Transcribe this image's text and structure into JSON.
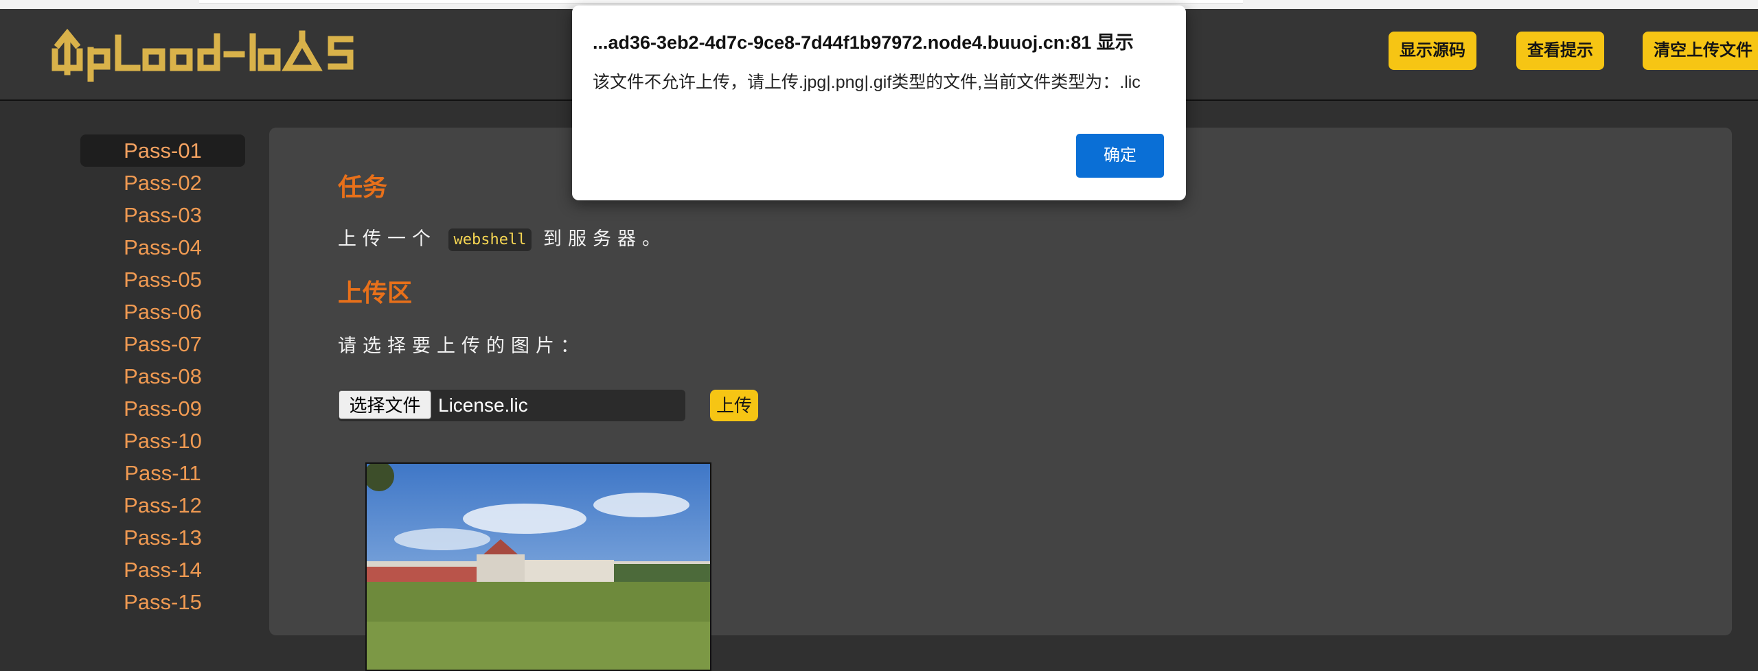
{
  "header": {
    "logo_text": "UpLoad-labs",
    "buttons": [
      "显示源码",
      "查看提示",
      "清空上传文件"
    ]
  },
  "sidebar": {
    "items": [
      "Pass-01",
      "Pass-02",
      "Pass-03",
      "Pass-04",
      "Pass-05",
      "Pass-06",
      "Pass-07",
      "Pass-08",
      "Pass-09",
      "Pass-10",
      "Pass-11",
      "Pass-12",
      "Pass-13",
      "Pass-14",
      "Pass-15"
    ],
    "active": "Pass-01"
  },
  "main": {
    "task_title": "任务",
    "task_before": "上传一个",
    "task_code": "webshell",
    "task_after": "到服务器。",
    "upload_title": "上传区",
    "upload_prompt": "请选择要上传的图片：",
    "choose_file_label": "选择文件",
    "file_name": "License.lic",
    "upload_button": "上传"
  },
  "dialog": {
    "title": "...ad36-3eb2-4d7c-9ce8-7d44f1b97972.node4.buuoj.cn:81 显示",
    "message": "该文件不允许上传，请上传.jpg|.png|.gif类型的文件,当前文件类型为：.lic",
    "ok_label": "确定"
  },
  "colors": {
    "accent_yellow": "#f6c514",
    "link_orange": "#f09a52",
    "title_orange": "#e8701a",
    "dialog_button": "#0a6fd6",
    "background": "#303030"
  }
}
